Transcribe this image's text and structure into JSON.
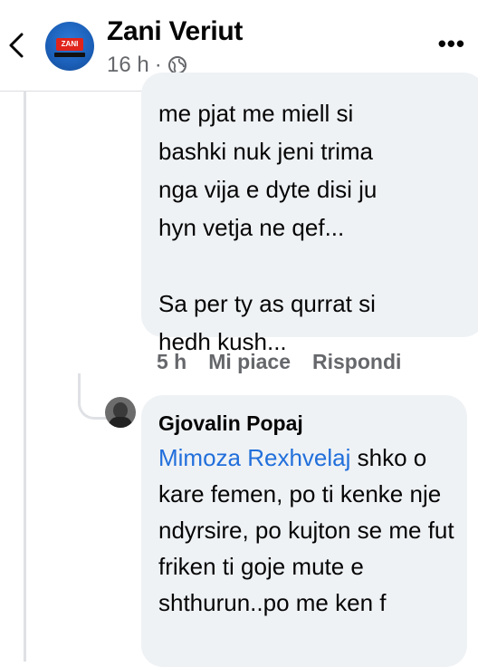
{
  "header": {
    "title": "Zani Veriut",
    "time": "16 h",
    "separator": "·",
    "avatar_badge": "ZANI",
    "more_icon": "more-horizontal-icon",
    "back_icon": "chevron-left-icon"
  },
  "comment1": {
    "text": "me pjat me miell si\nbashki nuk jeni trima\nnga vija e dyte disi ju\nhyn vetja ne qef...\n\nSa per ty as qurrat si\nhedh kush...",
    "time": "5 h",
    "like_label": "Mi piace",
    "reply_label": "Rispondi"
  },
  "reply1": {
    "author": "Gjovalin Popaj",
    "mention": "Mimoza Rexhvelaj",
    "text": " shko o kare femen, po ti kenke nje ndyrsire, po kujton se me fut friken ti goje mute e shthurun..po me ken f"
  },
  "colors": {
    "bubble": "#eff2f5",
    "mention": "#216fdb",
    "meta": "#65676b"
  }
}
